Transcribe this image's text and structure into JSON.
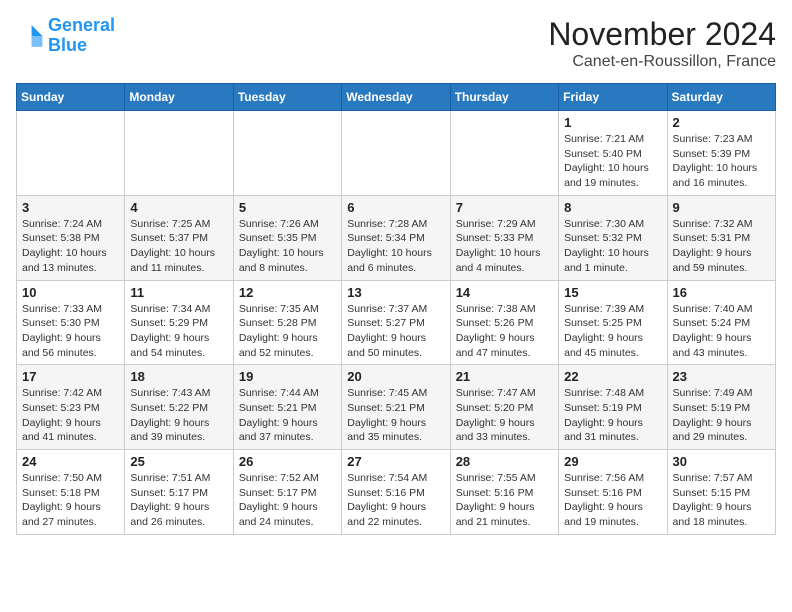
{
  "logo": {
    "line1": "General",
    "line2": "Blue"
  },
  "title": "November 2024",
  "location": "Canet-en-Roussillon, France",
  "weekdays": [
    "Sunday",
    "Monday",
    "Tuesday",
    "Wednesday",
    "Thursday",
    "Friday",
    "Saturday"
  ],
  "weeks": [
    [
      {
        "day": "",
        "info": ""
      },
      {
        "day": "",
        "info": ""
      },
      {
        "day": "",
        "info": ""
      },
      {
        "day": "",
        "info": ""
      },
      {
        "day": "",
        "info": ""
      },
      {
        "day": "1",
        "info": "Sunrise: 7:21 AM\nSunset: 5:40 PM\nDaylight: 10 hours and 19 minutes."
      },
      {
        "day": "2",
        "info": "Sunrise: 7:23 AM\nSunset: 5:39 PM\nDaylight: 10 hours and 16 minutes."
      }
    ],
    [
      {
        "day": "3",
        "info": "Sunrise: 7:24 AM\nSunset: 5:38 PM\nDaylight: 10 hours and 13 minutes."
      },
      {
        "day": "4",
        "info": "Sunrise: 7:25 AM\nSunset: 5:37 PM\nDaylight: 10 hours and 11 minutes."
      },
      {
        "day": "5",
        "info": "Sunrise: 7:26 AM\nSunset: 5:35 PM\nDaylight: 10 hours and 8 minutes."
      },
      {
        "day": "6",
        "info": "Sunrise: 7:28 AM\nSunset: 5:34 PM\nDaylight: 10 hours and 6 minutes."
      },
      {
        "day": "7",
        "info": "Sunrise: 7:29 AM\nSunset: 5:33 PM\nDaylight: 10 hours and 4 minutes."
      },
      {
        "day": "8",
        "info": "Sunrise: 7:30 AM\nSunset: 5:32 PM\nDaylight: 10 hours and 1 minute."
      },
      {
        "day": "9",
        "info": "Sunrise: 7:32 AM\nSunset: 5:31 PM\nDaylight: 9 hours and 59 minutes."
      }
    ],
    [
      {
        "day": "10",
        "info": "Sunrise: 7:33 AM\nSunset: 5:30 PM\nDaylight: 9 hours and 56 minutes."
      },
      {
        "day": "11",
        "info": "Sunrise: 7:34 AM\nSunset: 5:29 PM\nDaylight: 9 hours and 54 minutes."
      },
      {
        "day": "12",
        "info": "Sunrise: 7:35 AM\nSunset: 5:28 PM\nDaylight: 9 hours and 52 minutes."
      },
      {
        "day": "13",
        "info": "Sunrise: 7:37 AM\nSunset: 5:27 PM\nDaylight: 9 hours and 50 minutes."
      },
      {
        "day": "14",
        "info": "Sunrise: 7:38 AM\nSunset: 5:26 PM\nDaylight: 9 hours and 47 minutes."
      },
      {
        "day": "15",
        "info": "Sunrise: 7:39 AM\nSunset: 5:25 PM\nDaylight: 9 hours and 45 minutes."
      },
      {
        "day": "16",
        "info": "Sunrise: 7:40 AM\nSunset: 5:24 PM\nDaylight: 9 hours and 43 minutes."
      }
    ],
    [
      {
        "day": "17",
        "info": "Sunrise: 7:42 AM\nSunset: 5:23 PM\nDaylight: 9 hours and 41 minutes."
      },
      {
        "day": "18",
        "info": "Sunrise: 7:43 AM\nSunset: 5:22 PM\nDaylight: 9 hours and 39 minutes."
      },
      {
        "day": "19",
        "info": "Sunrise: 7:44 AM\nSunset: 5:21 PM\nDaylight: 9 hours and 37 minutes."
      },
      {
        "day": "20",
        "info": "Sunrise: 7:45 AM\nSunset: 5:21 PM\nDaylight: 9 hours and 35 minutes."
      },
      {
        "day": "21",
        "info": "Sunrise: 7:47 AM\nSunset: 5:20 PM\nDaylight: 9 hours and 33 minutes."
      },
      {
        "day": "22",
        "info": "Sunrise: 7:48 AM\nSunset: 5:19 PM\nDaylight: 9 hours and 31 minutes."
      },
      {
        "day": "23",
        "info": "Sunrise: 7:49 AM\nSunset: 5:19 PM\nDaylight: 9 hours and 29 minutes."
      }
    ],
    [
      {
        "day": "24",
        "info": "Sunrise: 7:50 AM\nSunset: 5:18 PM\nDaylight: 9 hours and 27 minutes."
      },
      {
        "day": "25",
        "info": "Sunrise: 7:51 AM\nSunset: 5:17 PM\nDaylight: 9 hours and 26 minutes."
      },
      {
        "day": "26",
        "info": "Sunrise: 7:52 AM\nSunset: 5:17 PM\nDaylight: 9 hours and 24 minutes."
      },
      {
        "day": "27",
        "info": "Sunrise: 7:54 AM\nSunset: 5:16 PM\nDaylight: 9 hours and 22 minutes."
      },
      {
        "day": "28",
        "info": "Sunrise: 7:55 AM\nSunset: 5:16 PM\nDaylight: 9 hours and 21 minutes."
      },
      {
        "day": "29",
        "info": "Sunrise: 7:56 AM\nSunset: 5:16 PM\nDaylight: 9 hours and 19 minutes."
      },
      {
        "day": "30",
        "info": "Sunrise: 7:57 AM\nSunset: 5:15 PM\nDaylight: 9 hours and 18 minutes."
      }
    ]
  ]
}
